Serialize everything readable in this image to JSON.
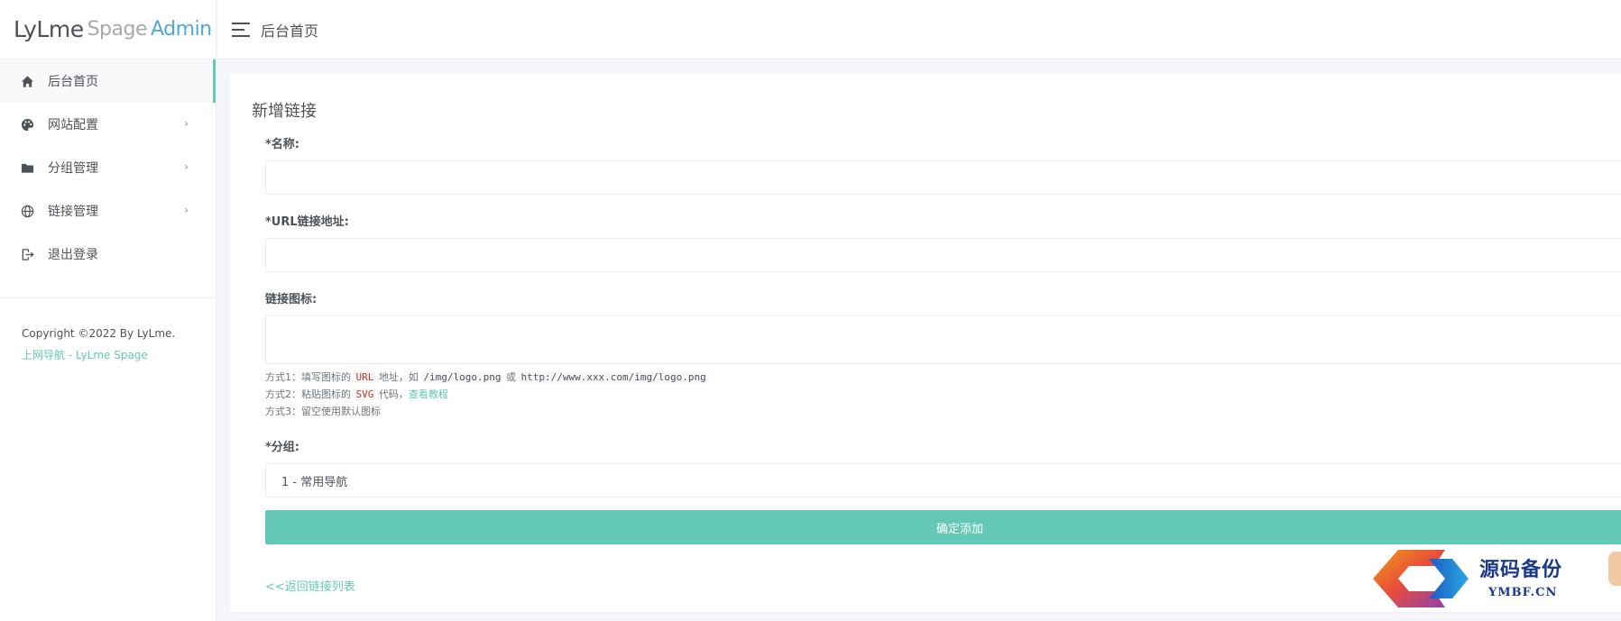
{
  "logo": {
    "part1": "LyLme",
    "part2": "Spage",
    "part3": "Admin"
  },
  "sidebar": {
    "items": [
      {
        "label": "后台首页",
        "icon": "home-icon",
        "active": true,
        "has_submenu": false
      },
      {
        "label": "网站配置",
        "icon": "palette-icon",
        "active": false,
        "has_submenu": true
      },
      {
        "label": "分组管理",
        "icon": "folder-icon",
        "active": false,
        "has_submenu": true
      },
      {
        "label": "链接管理",
        "icon": "globe-icon",
        "active": false,
        "has_submenu": true
      },
      {
        "label": "退出登录",
        "icon": "logout-icon",
        "active": false,
        "has_submenu": false
      }
    ],
    "arrow": "›",
    "copyright": "Copyright ©2022 By LyLme.",
    "copyright_link": "上网导航 - LyLme Spage"
  },
  "header": {
    "title": "后台首页"
  },
  "card": {
    "title": "新增链接",
    "fields": {
      "name": {
        "label": "*名称:",
        "value": "",
        "placeholder": ""
      },
      "url": {
        "label": "*URL链接地址:",
        "value": "",
        "placeholder": ""
      },
      "icon": {
        "label": "链接图标:",
        "value": "",
        "placeholder": ""
      },
      "group": {
        "label": "*分组:",
        "selected": "1 - 常用导航"
      }
    },
    "hint": {
      "line1_a": "方式1：填写图标的 ",
      "line1_code1": "URL",
      "line1_b": " 地址，如 ",
      "line1_code2": "/img/logo.png",
      "line1_c": " 或 ",
      "line1_code3": "http://www.xxx.com/img/logo.png",
      "line2_a": "方式2：粘贴图标的 ",
      "line2_code": "SVG",
      "line2_b": " 代码，",
      "line2_link": "查看教程",
      "line3": "方式3：留空使用默认图标"
    },
    "submit_label": "确定添加",
    "back_link": "<<返回链接列表"
  },
  "watermark": {
    "char": "码",
    "line1": "源码备份",
    "line2": "YMBF.CN"
  },
  "colors": {
    "accent": "#64c8b6",
    "text": "#4d5259",
    "logo_admin": "#4fa8d5",
    "background": "#f5f6fa"
  }
}
